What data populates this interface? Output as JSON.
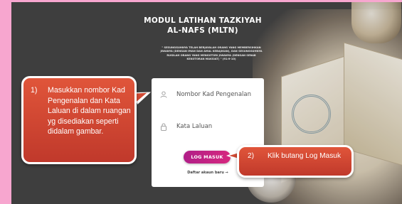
{
  "page": {
    "title": "MODUL LATIHAN TAZKIYAH AL-NAFS (MLTN)",
    "quote": "\" SESUNGGUHNYA TELAH BERJAYALAH ORANG YANG MEMBERSIHKAN JIWANYA (DENGAN IMAN DAN AMAL KEBAJIKAN), DAN SESUNGGUHNYA RUGILAH ORANG YANG MENGOTORI JIWANYA (DENGAN SEBAB KEKOTORAN MAKSIAT) \" (91:9-10)"
  },
  "login": {
    "id_placeholder": "Nombor Kad Pengenalan",
    "id_value": "",
    "password_placeholder": "Kata Laluan",
    "password_value": "",
    "button_label": "LOG MASUK",
    "register_link": "Daftar akaun baru →"
  },
  "callouts": {
    "first": {
      "number": "1)",
      "text": "Masukkan nombor Kad Pengenalan dan Kata Laluan di dalam ruangan yg disediakan seperti didalam gambar."
    },
    "second": {
      "number": "2)",
      "text": "Klik butang Log Masuk"
    }
  },
  "icons": {
    "id_field": "user-icon",
    "password_field": "lock-icon"
  },
  "colors": {
    "page_border": "#f7a6cf",
    "background": "#3e3e3e",
    "button_gradient_start": "#b01e88",
    "button_gradient_end": "#d6287e",
    "callout": "#d04a34"
  }
}
